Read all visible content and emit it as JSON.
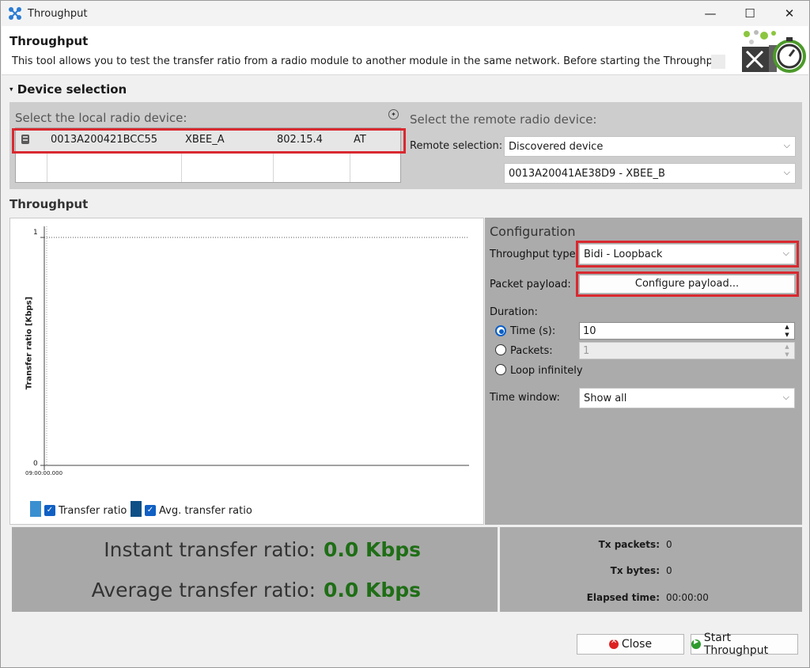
{
  "window": {
    "title": "Throughput",
    "minimize": "—",
    "maximize": "☐",
    "close": "✕"
  },
  "header": {
    "title": "Throughput",
    "description": "This tool allows you to test the transfer ratio from a radio module to another module in the same network. Before starting the Throughput"
  },
  "device_selection": {
    "title": "Device selection",
    "local_label": "Select the local radio device:",
    "local_device": {
      "mac": "0013A200421BCC55",
      "name": "XBEE_A",
      "protocol": "802.15.4",
      "mode": "AT"
    },
    "remote_label": "Select the remote radio device:",
    "remote_selection_label": "Remote selection:",
    "remote_selection_value": "Discovered device",
    "remote_device_value": "0013A20041AE38D9 - XBEE_B"
  },
  "throughput": {
    "title": "Throughput",
    "chart": {
      "ylabel": "Transfer ratio [Kbps]",
      "y_tick_top": "1",
      "y_tick_bottom": "0",
      "x_tick_start": "09:00:00.000"
    },
    "legend": {
      "transfer": "Transfer ratio",
      "avg": "Avg. transfer ratio"
    }
  },
  "configuration": {
    "title": "Configuration",
    "type_label": "Throughput type",
    "type_value": "Bidi - Loopback",
    "payload_label": "Packet payload:",
    "payload_button": "Configure payload...",
    "duration_label": "Duration:",
    "time_label": "Time (s):",
    "time_value": "10",
    "packets_label": "Packets:",
    "packets_value": "1",
    "loop_label": "Loop infinitely",
    "window_label": "Time window:",
    "window_value": "Show all"
  },
  "stats": {
    "instant_label": "Instant transfer ratio:",
    "instant_value": "0.0 Kbps",
    "average_label": "Average transfer ratio:",
    "average_value": "0.0 Kbps",
    "tx_packets_label": "Tx packets:",
    "tx_packets_value": "0",
    "tx_bytes_label": "Tx bytes:",
    "tx_bytes_value": "0",
    "elapsed_label": "Elapsed time:",
    "elapsed_value": "00:00:00"
  },
  "footer": {
    "close": "Close",
    "start": "Start Throughput"
  },
  "colors": {
    "highlight_red": "#d9282f",
    "value_green": "#1f6e16",
    "legend_light_blue": "#3a8fd0",
    "legend_dark_blue": "#0d4f86"
  }
}
